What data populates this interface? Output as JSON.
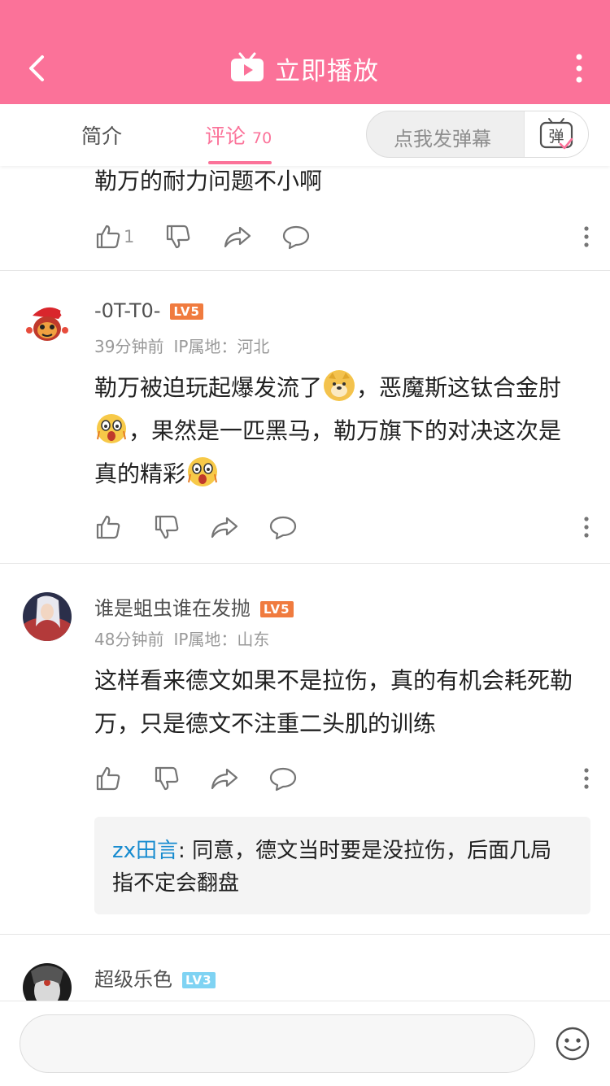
{
  "header": {
    "title": "立即播放"
  },
  "tabs": {
    "intro_label": "简介",
    "comments_label": "评论",
    "comments_count": "70",
    "danmaku_placeholder": "点我发弹幕",
    "danmaku_button": "弹"
  },
  "comments": [
    {
      "text": "勒万的耐力问题不小啊",
      "like_count": "1"
    },
    {
      "username": "-0T-T0-",
      "level": "LV5",
      "time": "39分钟前",
      "ip": "IP属地：河北",
      "text_1": "勒万被迫玩起爆发流了",
      "text_2": "，恶魔斯这钛合金肘",
      "text_3": "，果然是一匹黑马，勒万旗下的对决这次是真的精彩"
    },
    {
      "username": "谁是蛆虫谁在发抛",
      "level": "LV5",
      "time": "48分钟前",
      "ip": "IP属地：山东",
      "text": "这样看来德文如果不是拉伤，真的有机会耗死勒万，只是德文不注重二头肌的训练",
      "reply_user": "zx田言",
      "reply_text": ":  同意，德文当时要是没拉伤，后面几局指不定会翻盘"
    },
    {
      "username": "超级乐色",
      "level": "LV3",
      "time": "",
      "ip": ""
    }
  ],
  "colors": {
    "brand_pink": "#fb7299",
    "lv5": "#f07b3f",
    "lv3": "#7fd3f3",
    "reply_user": "#178bcf"
  }
}
